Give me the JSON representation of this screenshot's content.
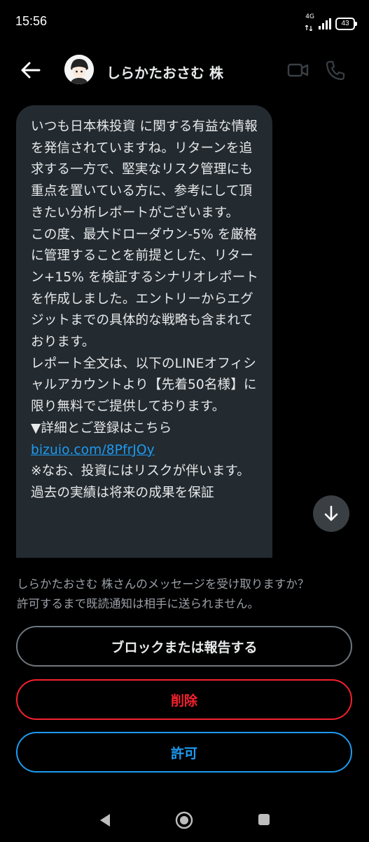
{
  "status_bar": {
    "time": "15:56",
    "network": "4G",
    "battery": "43"
  },
  "header": {
    "contact_name": "しらかたおさむ 株",
    "icons": [
      "back-arrow-icon",
      "video-call-icon",
      "phone-call-icon"
    ]
  },
  "message": {
    "paragraphs": [
      "いつも日本株投資 に関する有益な情報を発信されていますね。リターンを追求する一方で、堅実なリスク管理にも重点を置いている方に、参考にして頂きたい分析レポートがございます。",
      "この度、最大ドローダウン-5% を厳格に管理することを前提とした、リターン+15% を検証するシナリオレポートを作成しました。エントリーからエグジットまでの具体的な戦略も含まれております。",
      "レポート全文は、以下のLINEオフィシャルアカウントより【先着50名様】に限り無料でご提供しております。",
      "▼詳細とご登録はこちら"
    ],
    "link": "bizuio.com/8PfrJOy",
    "disclaimer": "※なお、投資にはリスクが伴います。過去の実績は将来の成果を保証"
  },
  "request": {
    "prompt_line1": "しらかたおさむ 株さんのメッセージを受け取りますか？",
    "prompt_line2": "許可するまで既読通知は相手に送られません。",
    "block_label": "ブロックまたは報告する",
    "delete_label": "削除",
    "allow_label": "許可"
  },
  "colors": {
    "background": "#000000",
    "bubble": "#232a30",
    "link": "#1d9bf0",
    "delete": "#f4212e",
    "allow": "#1d9bf0"
  }
}
